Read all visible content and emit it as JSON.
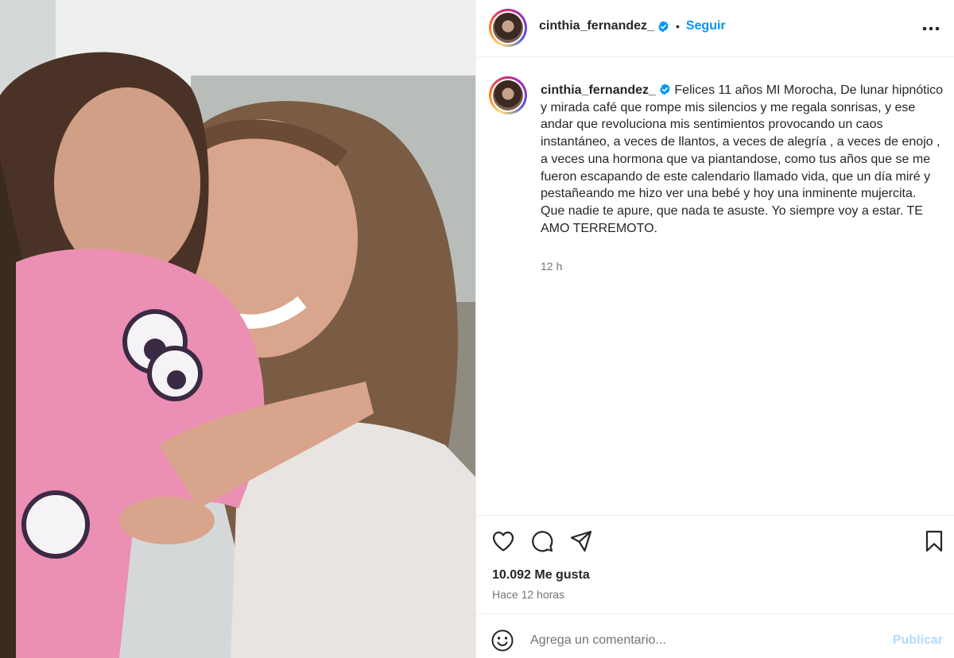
{
  "post": {
    "username": "cinthia_fernandez_",
    "verified": true,
    "follow_label": "Seguir",
    "separator": "•",
    "more_icon": "more-horizontal-icon"
  },
  "caption": {
    "username": "cinthia_fernandez_",
    "text": "Felices 11 años MI Morocha, De lunar hipnótico y mirada café que rompe mis silencios y me regala sonrisas, y ese andar que revoluciona mis sentimientos provocando un caos instantáneo, a veces de llantos, a veces de alegría , a veces de enojo , a veces una hormona que va piantandose, como tus años que se me fueron escapando de este calendario llamado vida, que un día miré y pestañeando me hizo ver una bebé y hoy una inminente mujercita.\nQue nadie te apure, que nada te asuste. Yo siempre voy a estar. TE AMO TERREMOTO.",
    "time": "12 h"
  },
  "stats": {
    "likes": "10.092 Me gusta",
    "posted_ago": "Hace 12 horas"
  },
  "comment": {
    "placeholder": "Agrega un comentario...",
    "publish_label": "Publicar"
  },
  "colors": {
    "accent": "#0095f6",
    "publish_disabled": "#b3dbff",
    "verified_badge": "#0095f6",
    "text_secondary": "#737373"
  },
  "icons": {
    "like": "heart-icon",
    "comment": "comment-bubble-icon",
    "share": "paper-plane-icon",
    "save": "bookmark-icon",
    "emoji": "smiley-icon"
  }
}
